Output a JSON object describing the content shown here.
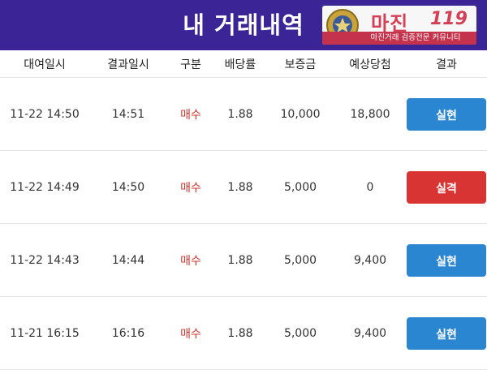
{
  "header": {
    "title": "내 거래내역"
  },
  "badge": {
    "name": "마진",
    "number": "119",
    "subtitle": "마진거래 검증전문 커뮤니티"
  },
  "columns": [
    "대여일시",
    "결과일시",
    "구분",
    "배당률",
    "보증금",
    "예상당첨",
    "결과"
  ],
  "colors": {
    "header_bg": "#3a2496",
    "win": "#2b86d2",
    "lose": "#d93434",
    "type_text": "#d0352f"
  },
  "rows": [
    {
      "rent_time": "11-22 14:50",
      "result_time": "14:51",
      "type": "매수",
      "odds": "1.88",
      "deposit": "10,000",
      "expected": "18,800",
      "result": "실현",
      "status": "win"
    },
    {
      "rent_time": "11-22 14:49",
      "result_time": "14:50",
      "type": "매수",
      "odds": "1.88",
      "deposit": "5,000",
      "expected": "0",
      "result": "실격",
      "status": "lose"
    },
    {
      "rent_time": "11-22 14:43",
      "result_time": "14:44",
      "type": "매수",
      "odds": "1.88",
      "deposit": "5,000",
      "expected": "9,400",
      "result": "실현",
      "status": "win"
    },
    {
      "rent_time": "11-21 16:15",
      "result_time": "16:16",
      "type": "매수",
      "odds": "1.88",
      "deposit": "5,000",
      "expected": "9,400",
      "result": "실현",
      "status": "win"
    }
  ]
}
